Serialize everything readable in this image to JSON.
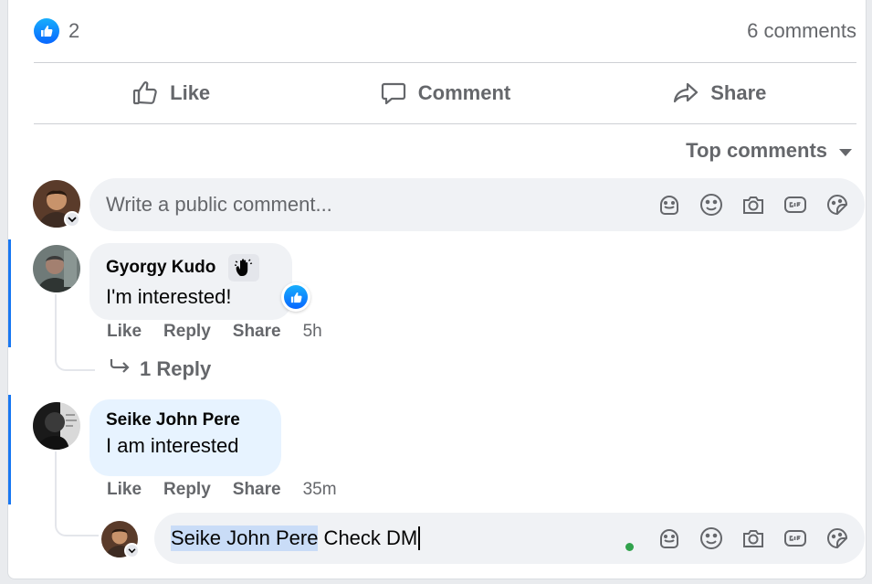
{
  "post": {
    "reaction_count": "2",
    "comments_count": "6 comments",
    "actions": {
      "like": "Like",
      "comment": "Comment",
      "share": "Share"
    }
  },
  "sort": {
    "label": "Top comments"
  },
  "composer": {
    "placeholder": "Write a public comment..."
  },
  "comments": [
    {
      "author": "Gyorgy Kudo",
      "text": "I'm interested!",
      "like": "Like",
      "reply": "Reply",
      "share": "Share",
      "time": "5h",
      "replies_label": "1 Reply"
    },
    {
      "author": "Seike John Pere",
      "text": "I am interested",
      "like": "Like",
      "reply": "Reply",
      "share": "Share",
      "time": "35m"
    }
  ],
  "reply_composer": {
    "mention": "Seike John Pere",
    "text": " Check DM"
  },
  "colors": {
    "accent": "#1877f2",
    "bubble_gray": "#f0f2f5",
    "bubble_blue": "#e7f3ff",
    "secondary_text": "#65676b",
    "online": "#31a24c"
  }
}
